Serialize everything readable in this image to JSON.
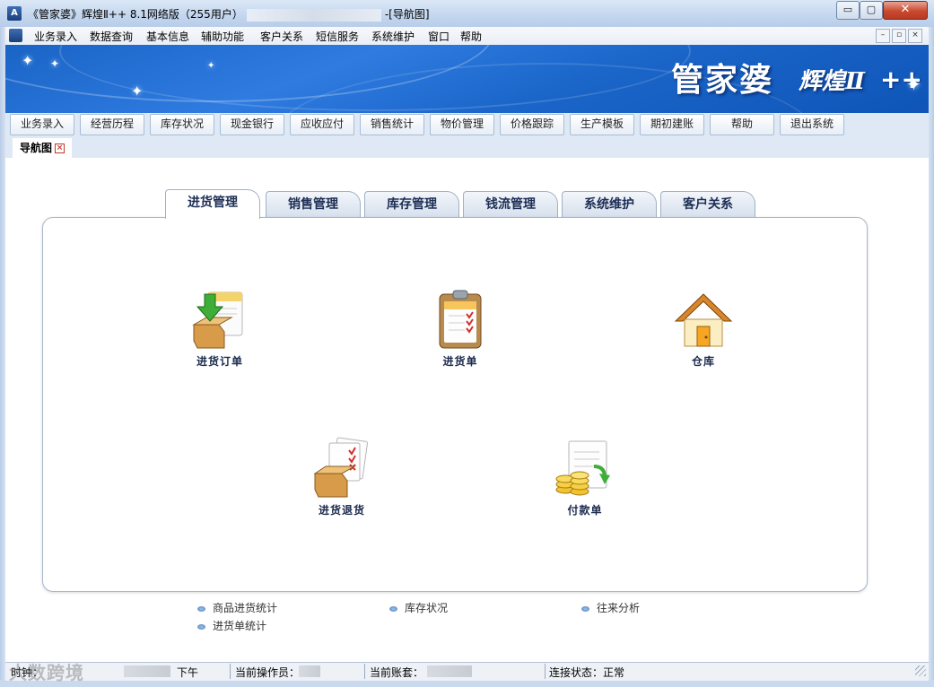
{
  "window": {
    "title_prefix": "《管家婆》辉煌Ⅱ++ 8.1网络版（255用户）",
    "title_suffix": "-[导航图]"
  },
  "titlebar_buttons": {
    "minimize": "▭",
    "maximize": "▢",
    "close": "✕"
  },
  "menubar": {
    "items": [
      "业务录入",
      "数据查询",
      "基本信息",
      "辅助功能",
      "客户关系",
      "短信服务",
      "系统维护",
      "窗口",
      "帮助"
    ],
    "mdi_buttons": [
      "–",
      "▫",
      "×"
    ]
  },
  "banner": {
    "brand": "管家婆",
    "brand_sub": "辉煌Ⅱ",
    "plus": "++"
  },
  "toolbar": {
    "buttons": [
      "业务录入",
      "经营历程",
      "库存状况",
      "现金银行",
      "应收应付",
      "销售统计",
      "物价管理",
      "价格跟踪",
      "生产模板",
      "期初建账",
      "帮助",
      "退出系统"
    ]
  },
  "doc_tab": {
    "label": "导航图",
    "close": "×"
  },
  "module_tabs": [
    "进货管理",
    "销售管理",
    "库存管理",
    "钱流管理",
    "系统维护",
    "客户关系"
  ],
  "active_tab": 0,
  "panel_items": [
    {
      "label": "进货订单",
      "icon": "purchase-order-icon"
    },
    {
      "label": "进货单",
      "icon": "clipboard-checklist-icon"
    },
    {
      "label": "仓库",
      "icon": "warehouse-house-icon"
    },
    {
      "label": "进货退货",
      "icon": "purchase-return-icon"
    },
    {
      "label": "付款单",
      "icon": "payment-coins-icon"
    }
  ],
  "links": [
    "商品进货统计",
    "库存状况",
    "往来分析",
    "进货单统计"
  ],
  "statusbar": {
    "clock_label": "时钟：",
    "clock_suffix": "下午",
    "operator_label": "当前操作员：",
    "account_label": "当前账套：",
    "connection": "连接状态：正常"
  },
  "watermark": "大数跨境",
  "colors": {
    "banner_blue": "#1b66c9",
    "accent_dark": "#1c2b4e",
    "close_red": "#c94a2f"
  }
}
